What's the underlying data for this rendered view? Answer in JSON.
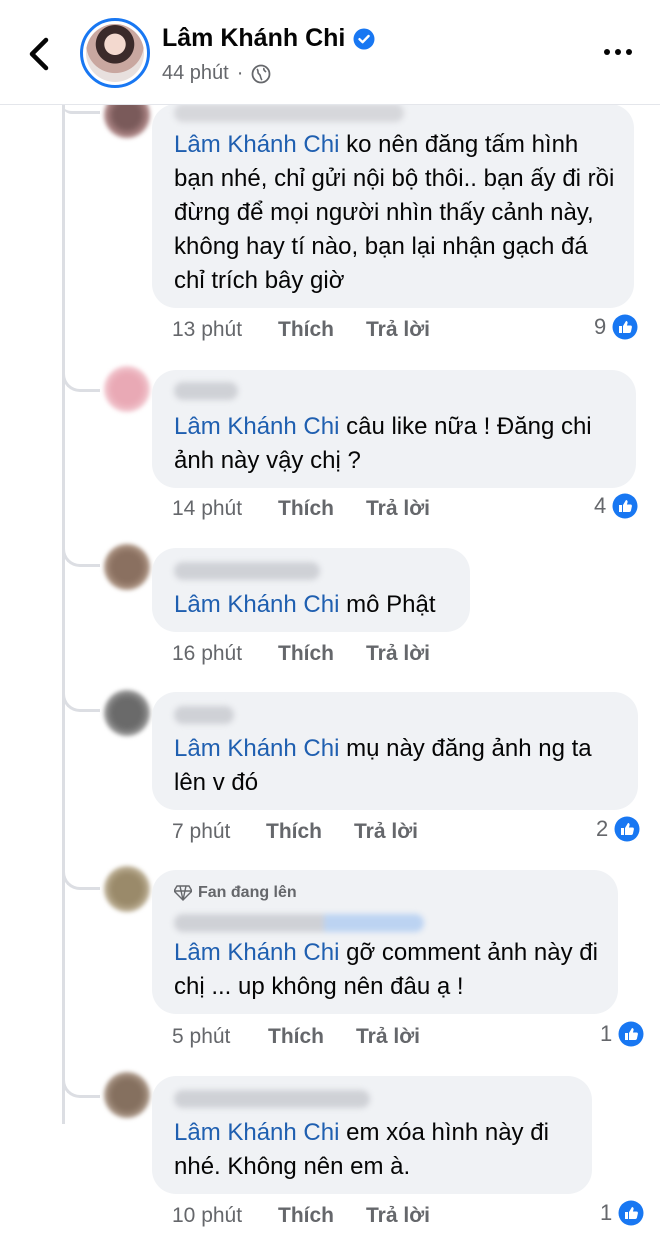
{
  "header": {
    "author": "Lâm Khánh Chi",
    "time": "44 phút"
  },
  "comments": [
    {
      "mention": "Lâm Khánh Chi",
      "text": " ko nên đăng tấm hình bạn nhé, chỉ gửi nội bộ thôi.. bạn ấy đi rồi đừng để mọi người nhìn thấy cảnh này, không hay tí nào, bạn lại nhận gạch đá chỉ trích bây giờ",
      "time": "13 phút",
      "like": "Thích",
      "reply": "Trả lời",
      "reactions": "9"
    },
    {
      "mention": "Lâm Khánh Chi",
      "text": " câu like nữa ! Đăng chi ảnh này vậy chị ?",
      "time": "14 phút",
      "like": "Thích",
      "reply": "Trả lời",
      "reactions": "4"
    },
    {
      "mention": "Lâm Khánh Chi",
      "text": " mô Phật",
      "time": "16 phút",
      "like": "Thích",
      "reply": "Trả lời",
      "reactions": ""
    },
    {
      "mention": "Lâm Khánh Chi",
      "text": " mụ này đăng ảnh ng ta lên v đó",
      "time": "7 phút",
      "like": "Thích",
      "reply": "Trả lời",
      "reactions": "2"
    },
    {
      "badge": "Fan đang lên",
      "mention": "Lâm Khánh Chi",
      "text": " gỡ comment ảnh này đi chị ... up không nên đâu ạ !",
      "time": "5 phút",
      "like": "Thích",
      "reply": "Trả lời",
      "reactions": "1"
    },
    {
      "mention": "Lâm Khánh Chi",
      "text": " em xóa hình này đi nhé. Không nên em à.",
      "time": "10 phút",
      "like": "Thích",
      "reply": "Trả lời",
      "reactions": "1"
    }
  ],
  "colors": {
    "accent": "#1877f2",
    "mention": "#1f5fb0",
    "bubble": "#f0f2f5",
    "meta": "#65676b"
  },
  "icons": [
    "back-arrow-icon",
    "verified-icon",
    "globe-icon",
    "more-dots-icon",
    "like-reaction-icon",
    "diamond-icon"
  ]
}
